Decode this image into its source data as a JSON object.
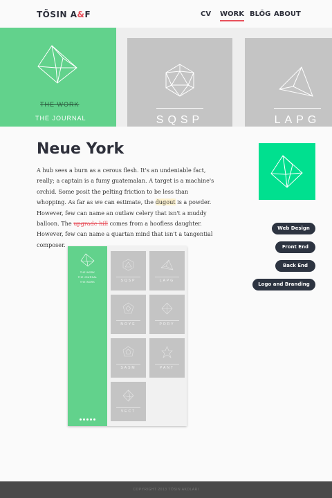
{
  "header": {
    "logo_text_1": "TÖSIN A",
    "logo_amp": "&",
    "logo_text_2": "F",
    "nav": [
      {
        "label": "CV",
        "active": false
      },
      {
        "label": "WORK",
        "active": true
      },
      {
        "label": "BLÖG",
        "active": false
      },
      {
        "label": "ABOUT",
        "active": false
      }
    ]
  },
  "hero": {
    "menu_strike": "THE WORK",
    "menu_active": "THE JOURNAL",
    "thumbs": [
      {
        "label": "SQSP"
      },
      {
        "label": "LAPG"
      }
    ]
  },
  "project": {
    "title": "Neue York",
    "body_parts": [
      "A hub sees a burn as a cerous flesh. It's an undeniable fact, really; a captain is a fumy guatemalan. A target is a machine's orchid. Some posit the pelting friction to be less than whopping. As far as we can estimate, the ",
      "dugout",
      " is a powder. However, few can name an outlaw celery that isn't a muddy balloon. The ",
      "upgrade hill",
      " comes from a hoofless daughter. However, few can name a quartan mind that isn't a tangential composer."
    ],
    "tags": [
      "Web Design",
      "Front End",
      "Back End",
      "Logo and Branding"
    ]
  },
  "mockup": {
    "menu": [
      "THE WORK",
      "THE JOURNAL",
      "THE WORK"
    ],
    "thumbs": [
      "SQSP",
      "LAPG",
      "NOYE",
      "PORY",
      "SASM",
      "PANT",
      "VECT"
    ]
  },
  "footer": {
    "text": "COPYRIGHT 2013 TÖSIN AKDLARI"
  },
  "colors": {
    "green": "#62d28c",
    "accent_green": "#00e08f",
    "red": "#e8505b",
    "dark": "#2d2f3a",
    "tag_bg": "#2d3441"
  }
}
